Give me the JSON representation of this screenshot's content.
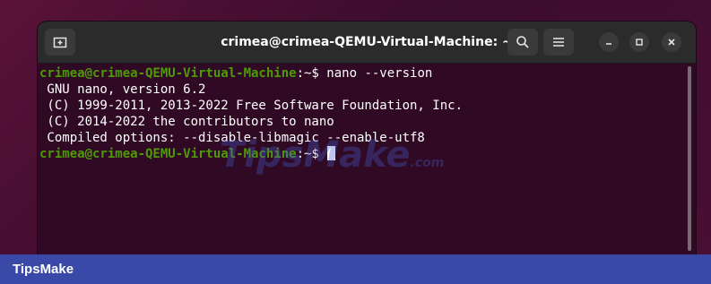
{
  "window": {
    "title": "crimea@crimea-QEMU-Virtual-Machine: ~"
  },
  "terminal": {
    "lines": [
      {
        "user": "crimea@crimea-QEMU-Virtual-Machine",
        "sep": ":~$ ",
        "text": "nano --version"
      },
      {
        "text": " GNU nano, version 6.2"
      },
      {
        "text": " (C) 1999-2011, 2013-2022 Free Software Foundation, Inc."
      },
      {
        "text": " (C) 2014-2022 the contributors to nano"
      },
      {
        "text": " Compiled options: --disable-libmagic --enable-utf8"
      },
      {
        "user": "crimea@crimea-QEMU-Virtual-Machine",
        "sep": ":~$ ",
        "text": ""
      }
    ]
  },
  "icons": {
    "new_tab": "new-tab-icon",
    "search": "search-icon",
    "menu": "hamburger-menu-icon",
    "minimize": "minimize-icon",
    "maximize": "maximize-icon",
    "close": "close-icon"
  },
  "colors": {
    "terminal_bg": "#300a24",
    "prompt_user": "#4e9a06",
    "header_bg": "#2b2b2b",
    "footer_bg": "#3a49a8"
  },
  "watermark": {
    "text": "TipsMake",
    "suffix": ".com"
  },
  "footer": {
    "brand": "TipsMake"
  }
}
